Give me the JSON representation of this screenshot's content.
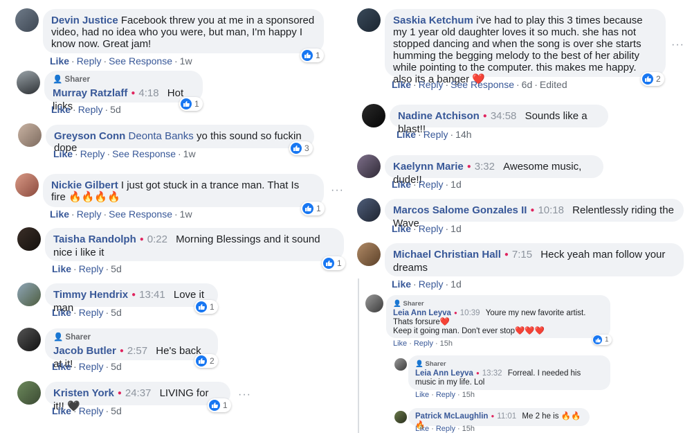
{
  "left": [
    {
      "name": "Devin Justice",
      "text": "Facebook threw you at me in a sponsored video, had no idea who you were, but man, I'm happy I know now. Great jam!",
      "actions": [
        "Like",
        "Reply",
        "See Response"
      ],
      "time": "1w",
      "reactions": "1"
    },
    {
      "sharer": "Sharer",
      "name": "Murray Ratzlaff",
      "timestamp": "4:18",
      "text": "Hot licks",
      "actions": [
        "Like",
        "Reply"
      ],
      "time": "5d",
      "reactions": "1"
    },
    {
      "name": "Greyson Conn",
      "tag": "Deonta Banks",
      "text": "yo this sound so fuckin dope",
      "actions": [
        "Like",
        "Reply",
        "See Response"
      ],
      "time": "1w",
      "reactions": "3"
    },
    {
      "name": "Nickie Gilbert",
      "text": "I just got stuck in a trance man. That Is fire 🔥🔥🔥🔥",
      "actions": [
        "Like",
        "Reply",
        "See Response"
      ],
      "time": "1w",
      "reactions": "1"
    },
    {
      "name": "Taisha Randolph",
      "timestamp": "0:22",
      "text": "Morning Blessings and it sound nice i like it",
      "actions": [
        "Like",
        "Reply"
      ],
      "time": "5d",
      "reactions": "1"
    },
    {
      "name": "Timmy Hendrix",
      "timestamp": "13:41",
      "text": "Love it man",
      "actions": [
        "Like",
        "Reply"
      ],
      "time": "5d",
      "reactions": "1"
    },
    {
      "sharer": "Sharer",
      "name": "Jacob Butler",
      "timestamp": "2:57",
      "text": "He's back at it!",
      "actions": [
        "Like",
        "Reply"
      ],
      "time": "5d",
      "reactions": "2"
    },
    {
      "name": "Kristen York",
      "timestamp": "24:37",
      "text": "LIVING for it!! 🖤",
      "actions": [
        "Like",
        "Reply"
      ],
      "time": "5d",
      "reactions": "1"
    }
  ],
  "right": [
    {
      "name": "Saskia Ketchum",
      "text": "i've had to play this 3 times because my 1 year old daughter loves it so much. she has not stopped dancing and when the song is over she starts humming the begging melody to the best of her ability while pointing to the computer. this makes me happy. also its a banger ❤️",
      "actions": [
        "Like",
        "Reply",
        "See Response"
      ],
      "time": "6d",
      "edited": "Edited",
      "reactions": "2"
    },
    {
      "name": "Nadine Atchison",
      "timestamp": "34:58",
      "text": "Sounds like a blast!!",
      "actions": [
        "Like",
        "Reply"
      ],
      "time": "14h"
    },
    {
      "name": "Kaelynn Marie",
      "timestamp": "3:32",
      "text": "Awesome music, dude!!",
      "actions": [
        "Like",
        "Reply"
      ],
      "time": "1d"
    },
    {
      "name": "Marcos Salome Gonzales II",
      "timestamp": "10:18",
      "text": "Relentlessly riding the Wave",
      "actions": [
        "Like",
        "Reply"
      ],
      "time": "1d"
    },
    {
      "name": "Michael Christian Hall",
      "timestamp": "7:15",
      "text": "Heck yeah man follow your dreams",
      "actions": [
        "Like",
        "Reply"
      ],
      "time": "1d"
    },
    {
      "sharer": "Sharer",
      "name": "Leia Ann Leyva",
      "timestamp": "10:39",
      "text": "Youre my new favorite artist. Thats forsure❤️",
      "text2": "Keep it going man. Don't ever stop❤️❤️❤️",
      "actions": [
        "Like",
        "Reply"
      ],
      "time": "15h",
      "reactions": "1"
    },
    {
      "sharer": "Sharer",
      "name": "Leia Ann Leyva",
      "timestamp": "13:32",
      "text": "Forreal. I needed his music in my life. Lol",
      "actions": [
        "Like",
        "Reply"
      ],
      "time": "15h"
    },
    {
      "name": "Patrick McLaughlin",
      "timestamp": "11:01",
      "text": "Me 2 he is 🔥🔥🔥",
      "actions": [
        "Like",
        "Reply"
      ],
      "time": "15h"
    }
  ],
  "more_label": "···",
  "colors": {
    "link": "#385898",
    "bubble": "#f0f2f5",
    "like_blue": "#1877f2",
    "dot": "#e0245e"
  }
}
